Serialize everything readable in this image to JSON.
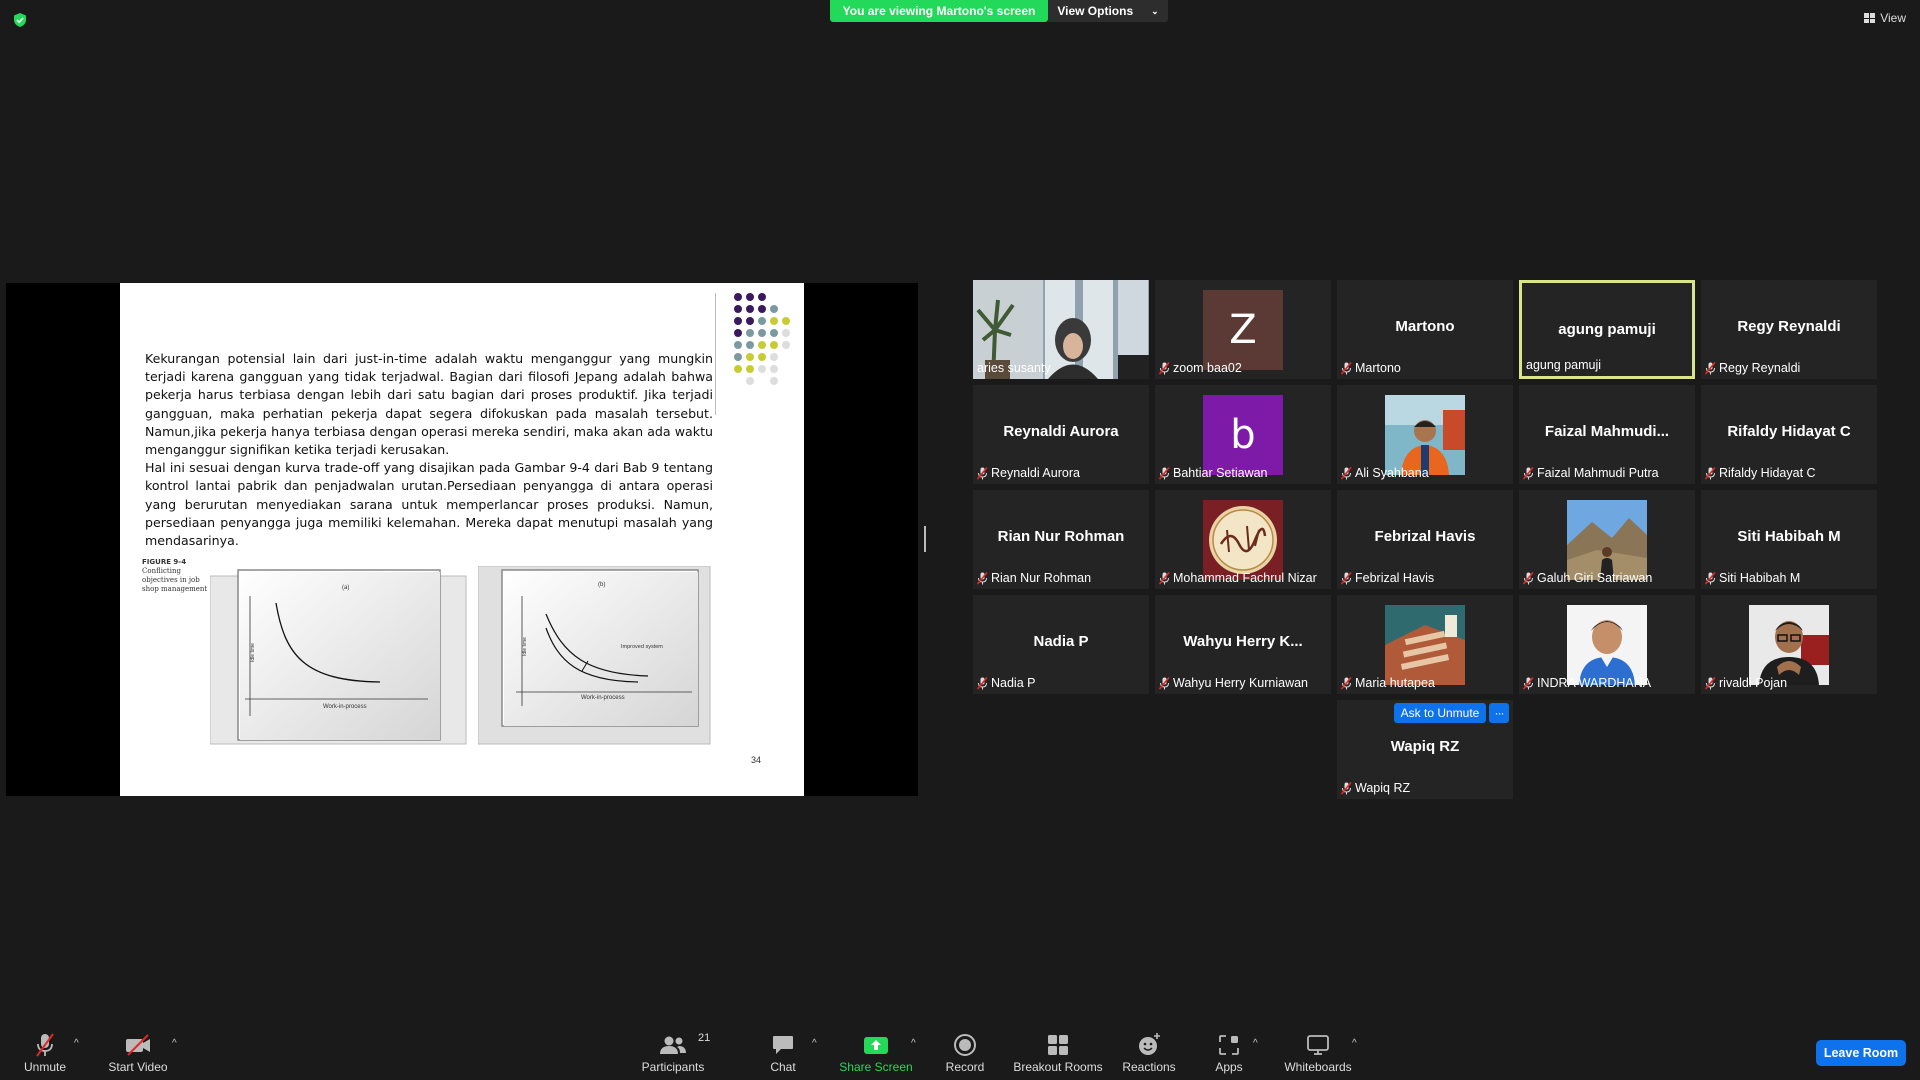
{
  "banner": {
    "viewing": "You are viewing Martono's screen",
    "view_options": "View Options",
    "view": "View"
  },
  "slide": {
    "paragraph1": "Kekurangan potensial lain dari just-in-time adalah waktu menganggur yang mungkin terjadi karena gangguan yang tidak terjadwal. Bagian dari filosofi Jepang adalah bahwa pekerja harus terbiasa dengan lebih dari satu bagian dari proses produktif. Jika terjadi gangguan, maka perhatian pekerja dapat segera difokuskan pada masalah tersebut. Namun,jika pekerja hanya terbiasa dengan operasi mereka sendiri, maka akan ada waktu menganggur signifikan ketika terjadi kerusakan.",
    "paragraph2": "Hal ini sesuai dengan kurva trade-off yang disajikan pada Gambar 9-4 dari Bab 9 tentang kontrol lantai pabrik dan penjadwalan urutan.Persediaan penyangga di antara operasi yang berurutan menyediakan sarana untuk memperlancar proses produksi. Namun, persediaan penyangga juga memiliki kelemahan. Mereka dapat menutupi masalah yang mendasarinya.",
    "figure_title": "FIGURE 9-4",
    "figure_caption": "Conflicting objectives in job shop management",
    "fig_a_label": "(a)",
    "fig_b_label": "(b)",
    "y_axis": "Idle time",
    "x_axis": "Work-in-process",
    "improved": "Improved system",
    "page_number": "34"
  },
  "participants": [
    {
      "name": "aries susanty",
      "big": "",
      "muted": false,
      "type": "photo-office"
    },
    {
      "name": "zoom baa02",
      "big": "",
      "muted": true,
      "type": "avatar",
      "letter": "Z",
      "color": "#5b3a35"
    },
    {
      "name": "Martono",
      "big": "Martono",
      "muted": true,
      "type": "name"
    },
    {
      "name": "agung pamuji",
      "big": "agung pamuji",
      "muted": false,
      "type": "name",
      "active": true
    },
    {
      "name": "Regy Reynaldi",
      "big": "Regy Reynaldi",
      "muted": true,
      "type": "name"
    },
    {
      "name": "Reynaldi Aurora",
      "big": "Reynaldi Aurora",
      "muted": true,
      "type": "name"
    },
    {
      "name": "Bahtiar Setiawan",
      "big": "",
      "muted": true,
      "type": "avatar",
      "letter": "b",
      "color": "#7d1aa8"
    },
    {
      "name": "Ali Syahbana",
      "big": "",
      "muted": true,
      "type": "photo-person-orange"
    },
    {
      "name": "Faizal Mahmudi Putra",
      "big": "Faizal  Mahmudi...",
      "muted": true,
      "type": "name"
    },
    {
      "name": "Rifaldy Hidayat C",
      "big": "Rifaldy Hidayat C",
      "muted": true,
      "type": "name"
    },
    {
      "name": "Rian Nur Rohman",
      "big": "Rian Nur Rohman",
      "muted": true,
      "type": "name"
    },
    {
      "name": "Mohammad Fachrul Nizar",
      "big": "",
      "muted": true,
      "type": "photo-calligraphy"
    },
    {
      "name": "Febrizal Havis",
      "big": "Febrizal Havis",
      "muted": true,
      "type": "name"
    },
    {
      "name": "Galuh Giri Satriawan",
      "big": "",
      "muted": true,
      "type": "photo-mountain"
    },
    {
      "name": "Siti Habibah M",
      "big": "Siti Habibah M",
      "muted": true,
      "type": "name"
    },
    {
      "name": "Nadia P",
      "big": "Nadia P",
      "muted": true,
      "type": "name"
    },
    {
      "name": "Wahyu Herry Kurniawan",
      "big": "Wahyu  Herry  K...",
      "muted": true,
      "type": "name"
    },
    {
      "name": "Maria hutapea",
      "big": "",
      "muted": true,
      "type": "photo-illustration"
    },
    {
      "name": "INDRA WARDHANA",
      "big": "",
      "muted": true,
      "type": "photo-person-blue"
    },
    {
      "name": "rivaldi Pojan",
      "big": "",
      "muted": true,
      "type": "photo-person-glasses"
    },
    {
      "name": "Wapiq RZ",
      "big": "Wapiq RZ",
      "muted": true,
      "type": "name"
    }
  ],
  "ask_to_unmute": "Ask to Unmute",
  "more": "···",
  "toolbar": {
    "unmute": "Unmute",
    "start_video": "Start Video",
    "participants": "Participants",
    "participants_count": "21",
    "chat": "Chat",
    "share_screen": "Share Screen",
    "record": "Record",
    "breakout_rooms": "Breakout Rooms",
    "reactions": "Reactions",
    "apps": "Apps",
    "whiteboards": "Whiteboards",
    "leave_room": "Leave Room"
  },
  "colors": {
    "accent_green": "#23d959",
    "accent_blue": "#0e72ed",
    "active_border": "#d9e58a",
    "mute_red": "#e02828"
  }
}
